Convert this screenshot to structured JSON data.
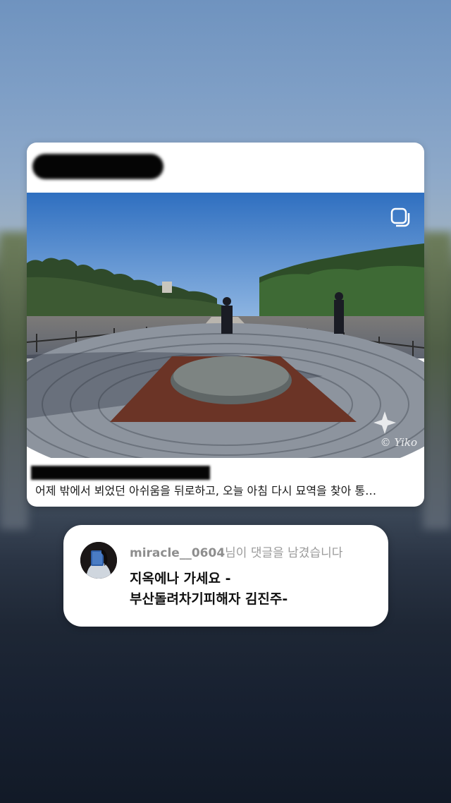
{
  "post": {
    "caption": "어제 밖에서 뵈었던 아쉬움을 뒤로하고, 오늘 아침 다시 묘역을 찾아 통…",
    "watermark": "© Yiko",
    "multi_photo_icon": "multiple-photos-icon"
  },
  "comment_notification": {
    "username": "miracle__0604",
    "header_suffix": "님이 댓글을 남겼습니다",
    "lines": [
      "지옥에나 가세요 -",
      "부산돌려차기피해자 김진주-"
    ]
  },
  "colors": {
    "card_bg": "#ffffff",
    "username_gray": "#8e8e8e",
    "comment_text": "#111111"
  }
}
